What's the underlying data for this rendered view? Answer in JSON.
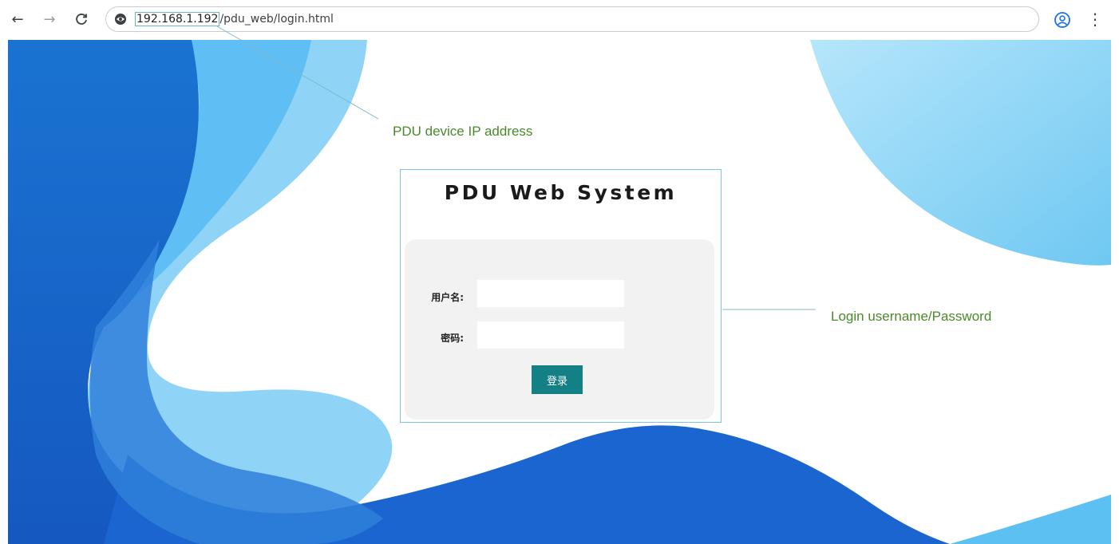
{
  "browser": {
    "url_host": "192.168.1.192",
    "url_path": "/pdu_web/login.html",
    "back_glyph": "←",
    "forward_glyph": "→",
    "reload_glyph": "C",
    "menu_glyph": "⋮",
    "icons": [
      "back-arrow-icon",
      "forward-arrow-icon",
      "reload-icon",
      "site-info-icon",
      "profile-icon",
      "kebab-menu-icon"
    ]
  },
  "login": {
    "title": "PDU Web System",
    "username_label": "用户名:",
    "password_label": "密码:",
    "username_value": "",
    "password_value": "",
    "submit_label": "登录"
  },
  "annotations": {
    "ip_address": "PDU device IP address",
    "credentials": "Login username/Password",
    "color": "#4a8a2a"
  },
  "colors": {
    "button": "#138086",
    "wave_dark": "#1565c8",
    "wave_light": "#8fd4f7",
    "box_border": "#7cc6e4"
  }
}
